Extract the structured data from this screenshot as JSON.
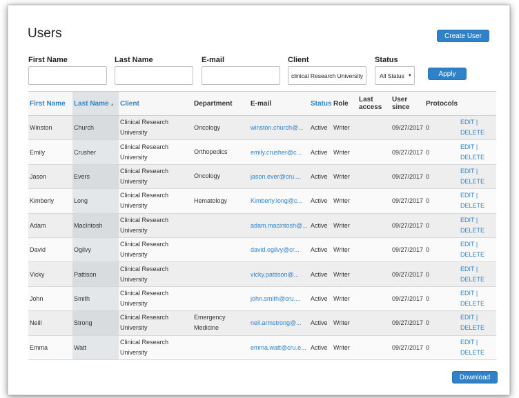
{
  "page": {
    "title": "Users",
    "create_button": "Create User",
    "apply_button": "Apply",
    "download_button": "Download"
  },
  "filters": {
    "first_name_label": "First Name",
    "last_name_label": "Last Name",
    "email_label": "E-mail",
    "client_label": "Client",
    "client_value": "clinical Research University",
    "status_label": "Status",
    "status_value": "All Status"
  },
  "table": {
    "headers": {
      "first_name": "First Name",
      "last_name": "Last Name",
      "client": "Client",
      "department": "Department",
      "email": "E-mail",
      "status": "Status",
      "role": "Role",
      "last_access": "Last access",
      "user_since": "User since",
      "protocols": "Protocols"
    },
    "edit_label": "EDIT",
    "separator": "|",
    "delete_label": "DELETE",
    "rows": [
      {
        "first": "Winston",
        "last": "Church",
        "client": "Clinical Research University",
        "dept": "Oncology",
        "email": "winston.church@...",
        "status": "Active",
        "role": "Writer",
        "last_access": "",
        "since": "09/27/2017",
        "protocols": "0"
      },
      {
        "first": "Emily",
        "last": "Crusher",
        "client": "Clinical Research University",
        "dept": "Orthopedics",
        "email": "emily.crusher@c...",
        "status": "Active",
        "role": "Writer",
        "last_access": "",
        "since": "09/27/2017",
        "protocols": "0"
      },
      {
        "first": "Jason",
        "last": "Evers",
        "client": "Clinical Research University",
        "dept": "Oncology",
        "email": "jason.ever@cru....",
        "status": "Active",
        "role": "Writer",
        "last_access": "",
        "since": "09/27/2017",
        "protocols": "0"
      },
      {
        "first": "Kimberly",
        "last": "Long",
        "client": "Clinical Research University",
        "dept": "Hematology",
        "email": "Kimberly.long@c...",
        "status": "Active",
        "role": "Writer",
        "last_access": "",
        "since": "09/27/2017",
        "protocols": "0"
      },
      {
        "first": "Adam",
        "last": "MacIntosh",
        "client": "Clinical Research University",
        "dept": "",
        "email": "adam.macintosh@...",
        "status": "Active",
        "role": "Writer",
        "last_access": "",
        "since": "09/27/2017",
        "protocols": "0"
      },
      {
        "first": "David",
        "last": "Ogilvy",
        "client": "Clinical Research University",
        "dept": "",
        "email": "david.ogilvy@cr...",
        "status": "Active",
        "role": "Writer",
        "last_access": "",
        "since": "09/27/2017",
        "protocols": "0"
      },
      {
        "first": "Vicky",
        "last": "Pattison",
        "client": "Clinical Research University",
        "dept": "",
        "email": "vicky.pattison@...",
        "status": "Active",
        "role": "Writer",
        "last_access": "",
        "since": "09/27/2017",
        "protocols": "0"
      },
      {
        "first": "John",
        "last": "Smith",
        "client": "Clinical Research University",
        "dept": "",
        "email": "john.smith@cru....",
        "status": "Active",
        "role": "Writer",
        "last_access": "",
        "since": "09/27/2017",
        "protocols": "0"
      },
      {
        "first": "Neill",
        "last": "Strong",
        "client": "Clinical Research University",
        "dept": "Emergency Medicine",
        "email": "neil.armstrong@...",
        "status": "Active",
        "role": "Writer",
        "last_access": "",
        "since": "09/27/2017",
        "protocols": "0"
      },
      {
        "first": "Emma",
        "last": "Watt",
        "client": "Clinical Research University",
        "dept": "",
        "email": "emma.watt@cru.e...",
        "status": "Active",
        "role": "Writer",
        "last_access": "",
        "since": "09/27/2017",
        "protocols": "0"
      }
    ]
  },
  "colors": {
    "accent": "#2f82c8",
    "sorted_column": "#d9dcdf"
  }
}
